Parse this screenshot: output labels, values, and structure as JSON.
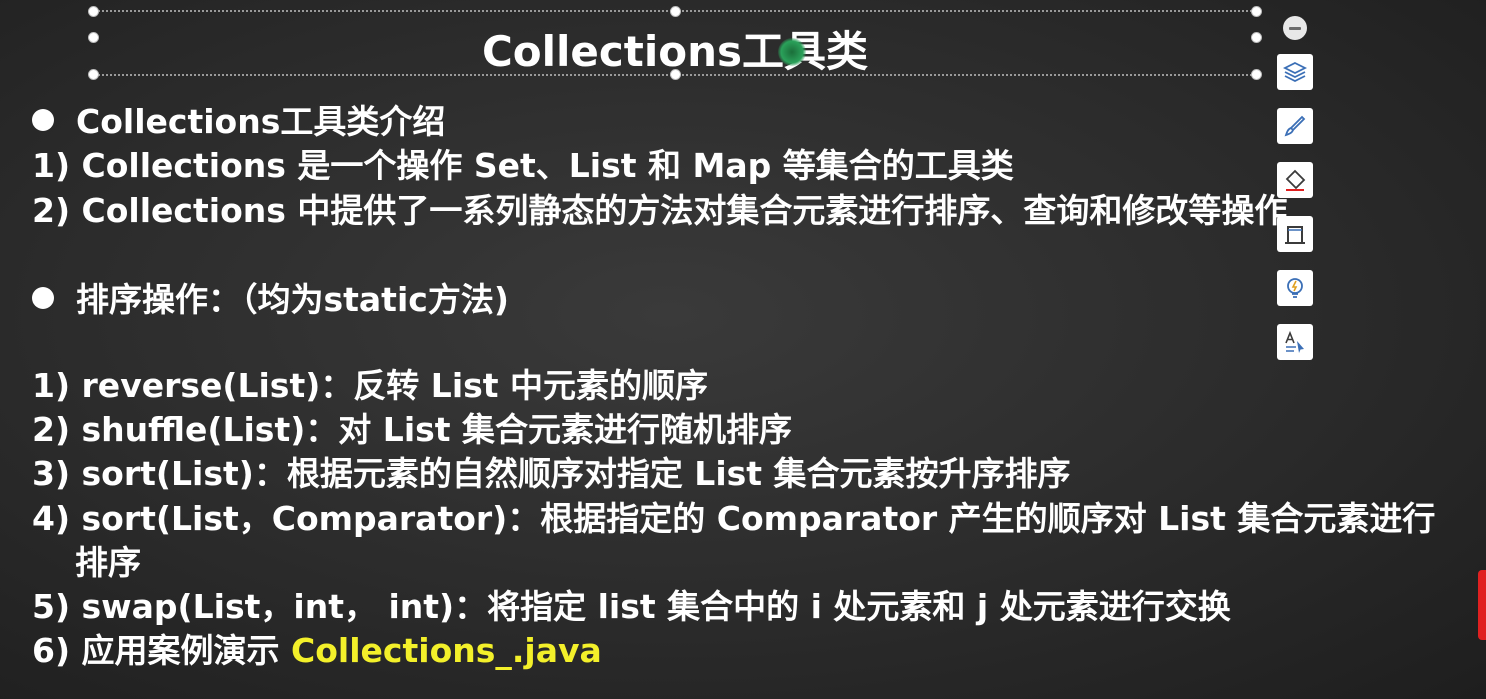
{
  "slide": {
    "title": "Collections工具类",
    "heading1": "Collections工具类介绍",
    "intro": [
      "1) Collections 是一个操作 Set、List 和 Map 等集合的工具类",
      "2) Collections 中提供了一系列静态的方法对集合元素进行排序、查询和修改等操作"
    ],
    "heading2": "排序操作：（均为static方法)",
    "items": [
      "1) reverse(List)：反转 List 中元素的顺序",
      "2) shuffle(List)：对 List 集合元素进行随机排序",
      "3) sort(List)：根据元素的自然顺序对指定 List 集合元素按升序排序",
      "4) sort(List，Comparator)：根据指定的 Comparator 产生的顺序对 List 集合元素进行",
      "排序",
      "5) swap(List，int， int)：将指定 list 集合中的 i 处元素和 j 处元素进行交换"
    ],
    "last_item_prefix": "6) 应用案例演示 ",
    "last_item_highlight": "Collections_.java",
    "highlight_color": "#f3f02a"
  },
  "toolbar": {
    "icons": [
      "minus-icon",
      "layers-icon",
      "brush-icon",
      "eraser-icon",
      "frame-icon",
      "lightbulb-icon",
      "text-format-icon"
    ]
  }
}
